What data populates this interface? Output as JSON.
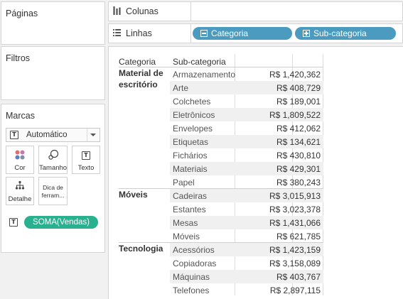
{
  "panels": {
    "paginas": {
      "title": "Páginas"
    },
    "filtros": {
      "title": "Filtros"
    },
    "marcas": {
      "title": "Marcas",
      "mark_type": "Automático",
      "buttons": {
        "cor": "Cor",
        "tamanho": "Tamanho",
        "texto": "Texto",
        "detalhe": "Detalhe",
        "dica_line1": "Dica de",
        "dica_line2": "ferram..."
      },
      "text_field": "SOMA(Vendas)",
      "text_icon": "T"
    }
  },
  "shelves": {
    "colunas": {
      "label": "Colunas",
      "icon": "columns-icon"
    },
    "linhas": {
      "label": "Linhas",
      "icon": "rows-icon",
      "pills": [
        {
          "label": "Categoria",
          "state": "collapse"
        },
        {
          "label": "Sub-categoria",
          "state": "expand"
        }
      ]
    }
  },
  "table": {
    "headers": {
      "categoria": "Categoria",
      "subcategoria": "Sub-categoria"
    },
    "groups": [
      {
        "category_line1": "Material de",
        "category_line2": "escritório",
        "rows": [
          {
            "sub": "Armazenamento",
            "value": "R$ 1,420,362"
          },
          {
            "sub": "Arte",
            "value": "R$ 408,729"
          },
          {
            "sub": "Colchetes",
            "value": "R$ 189,001"
          },
          {
            "sub": "Eletrônicos",
            "value": "R$ 1,809,522"
          },
          {
            "sub": "Envelopes",
            "value": "R$ 412,062"
          },
          {
            "sub": "Etiquetas",
            "value": "R$ 134,621"
          },
          {
            "sub": "Fichários",
            "value": "R$ 430,810"
          },
          {
            "sub": "Materiais",
            "value": "R$ 429,301"
          },
          {
            "sub": "Papel",
            "value": "R$ 380,243"
          }
        ]
      },
      {
        "category_line1": "Móveis",
        "category_line2": "",
        "rows": [
          {
            "sub": "Cadeiras",
            "value": "R$ 3,015,913"
          },
          {
            "sub": "Estantes",
            "value": "R$ 3,023,378"
          },
          {
            "sub": "Mesas",
            "value": "R$ 1,431,066"
          },
          {
            "sub": "Móveis",
            "value": "R$ 621,785"
          }
        ]
      },
      {
        "category_line1": "Tecnologia",
        "category_line2": "",
        "rows": [
          {
            "sub": "Acessórios",
            "value": "R$ 1,423,159"
          },
          {
            "sub": "Copiadoras",
            "value": "R$ 3,158,089"
          },
          {
            "sub": "Máquinas",
            "value": "R$ 403,767"
          },
          {
            "sub": "Telefones",
            "value": "R$ 2,897,115"
          }
        ]
      }
    ]
  },
  "colors": {
    "pill_blue": "#4a9bbf",
    "pill_green": "#29b08f",
    "row_band": "#f0f0f0"
  }
}
